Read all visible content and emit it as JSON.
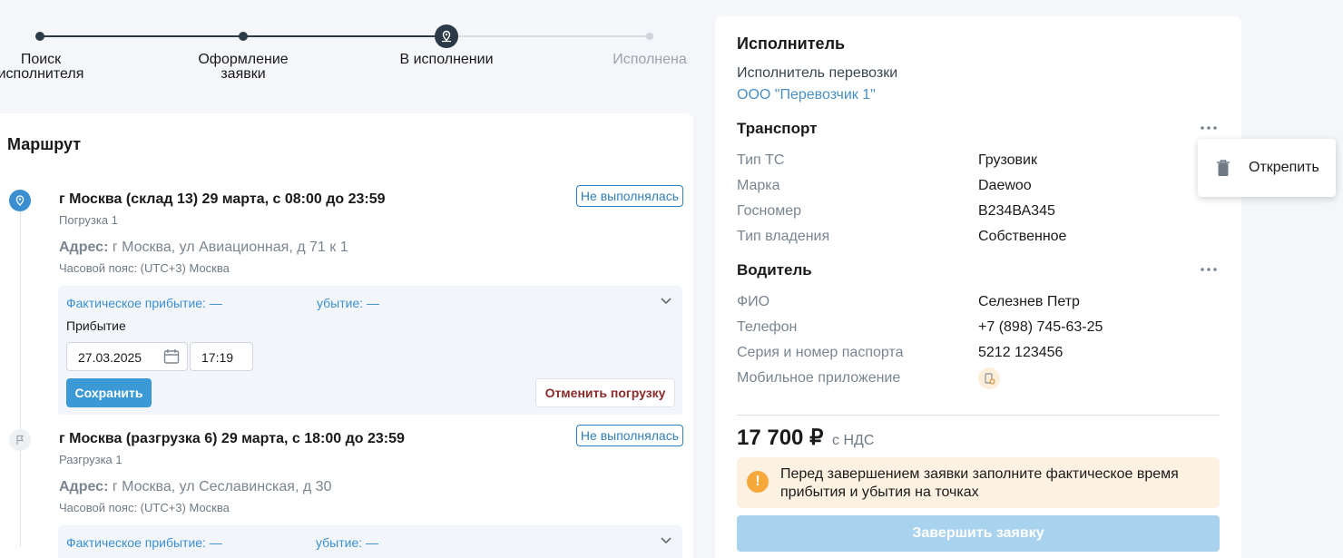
{
  "stepper": {
    "steps": [
      {
        "label_line1": "Поиск",
        "label_line2": "исполнителя",
        "state": "done"
      },
      {
        "label_line1": "Оформление",
        "label_line2": "заявки",
        "state": "done"
      },
      {
        "label_line1": "В исполнении",
        "label_line2": "",
        "state": "current"
      },
      {
        "label_line1": "Исполнена",
        "label_line2": "",
        "state": "todo"
      }
    ]
  },
  "route": {
    "title": "Маршрут",
    "points": [
      {
        "title": "г Москва (склад 13) 29 марта, с 08:00 до 23:59",
        "subtitle": "Погрузка 1",
        "address_label": "Адрес:",
        "address": "г Москва, ул Авиационная, д 71 к 1",
        "timezone": "Часовой пояс: (UTC+3) Москва",
        "status": "Не выполнялась",
        "fact_arrival": "Фактическое прибытие: —",
        "fact_departure": "убытие: —",
        "arrival_label": "Прибытие",
        "date_value": "27.03.2025",
        "time_value": "17:19",
        "save_label": "Сохранить",
        "cancel_label": "Отменить погрузку"
      },
      {
        "title": "г Москва (разгрузка 6) 29 марта, с 18:00 до 23:59",
        "subtitle": "Разгрузка 1",
        "address_label": "Адрес:",
        "address": "г Москва, ул Сеславинская, д 30",
        "timezone": "Часовой пояс: (UTC+3) Москва",
        "status": "Не выполнялась",
        "fact_arrival": "Фактическое прибытие: —",
        "fact_departure": "убытие: —"
      }
    ]
  },
  "executor": {
    "title": "Исполнитель",
    "carrier_label": "Исполнитель перевозки",
    "carrier_name": "ООО \"Перевозчик 1\""
  },
  "transport": {
    "title": "Транспорт",
    "rows": [
      {
        "key": "Тип ТС",
        "value": "Грузовик"
      },
      {
        "key": "Марка",
        "value": "Daewoo"
      },
      {
        "key": "Госномер",
        "value": "В234ВА345"
      },
      {
        "key": "Тип владения",
        "value": "Собственное"
      }
    ]
  },
  "driver": {
    "title": "Водитель",
    "rows": [
      {
        "key": "ФИО",
        "value": "Селезнев Петр"
      },
      {
        "key": "Телефон",
        "value": "+7 (898) 745-63-25"
      },
      {
        "key": "Серия и номер паспорта",
        "value": "5212 123456"
      }
    ],
    "app_label": "Мобильное приложение"
  },
  "price": {
    "amount": "17 700 ₽",
    "note": "с НДС"
  },
  "warning": {
    "text": "Перед завершением заявки заполните фактическое время прибытия и убытия на точках"
  },
  "finish_label": "Завершить заявку",
  "popup": {
    "detach_label": "Открепить"
  },
  "colors": {
    "accent": "#3b9ad6",
    "dark": "#2c3a47",
    "danger": "#8a2a2a",
    "warning": "#f6a83a"
  }
}
